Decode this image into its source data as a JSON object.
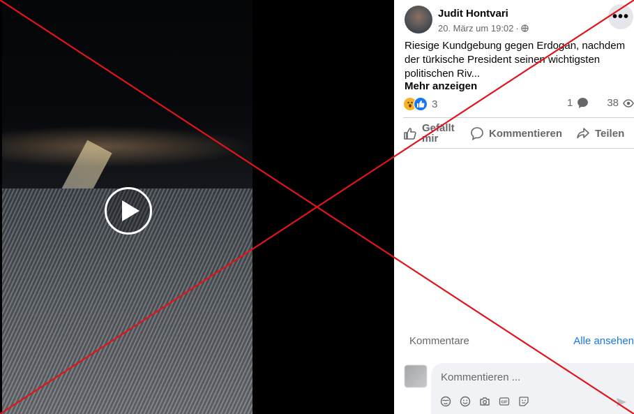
{
  "post": {
    "author": "Judit Hontvari",
    "date": "20. März um 19:02",
    "separator": "·",
    "text": "Riesige Kundgebung gegen Erdogan, nachdem der türkische President seinen wichtigsten politischen Riv...",
    "see_more": "Mehr anzeigen",
    "reaction_count": "3",
    "comment_count": "1",
    "view_count": "38"
  },
  "actions": {
    "like": "Gefällt mir",
    "comment": "Kommentieren",
    "share": "Teilen"
  },
  "comments": {
    "heading": "Kommentare",
    "see_all": "Alle ansehen",
    "placeholder": "Kommentieren ..."
  },
  "icons": {
    "more": "more-options-icon",
    "globe": "globe-icon",
    "wow": "wow-reaction-icon",
    "like_reaction": "like-reaction-icon",
    "comment_bubble": "comment-bubble-icon",
    "eye": "eye-icon",
    "thumb": "thumb-up-icon",
    "share": "share-arrow-icon",
    "play": "play-icon"
  },
  "colors": {
    "accent": "#1877f2",
    "cross": "#e0151b",
    "muted": "#65676b"
  }
}
